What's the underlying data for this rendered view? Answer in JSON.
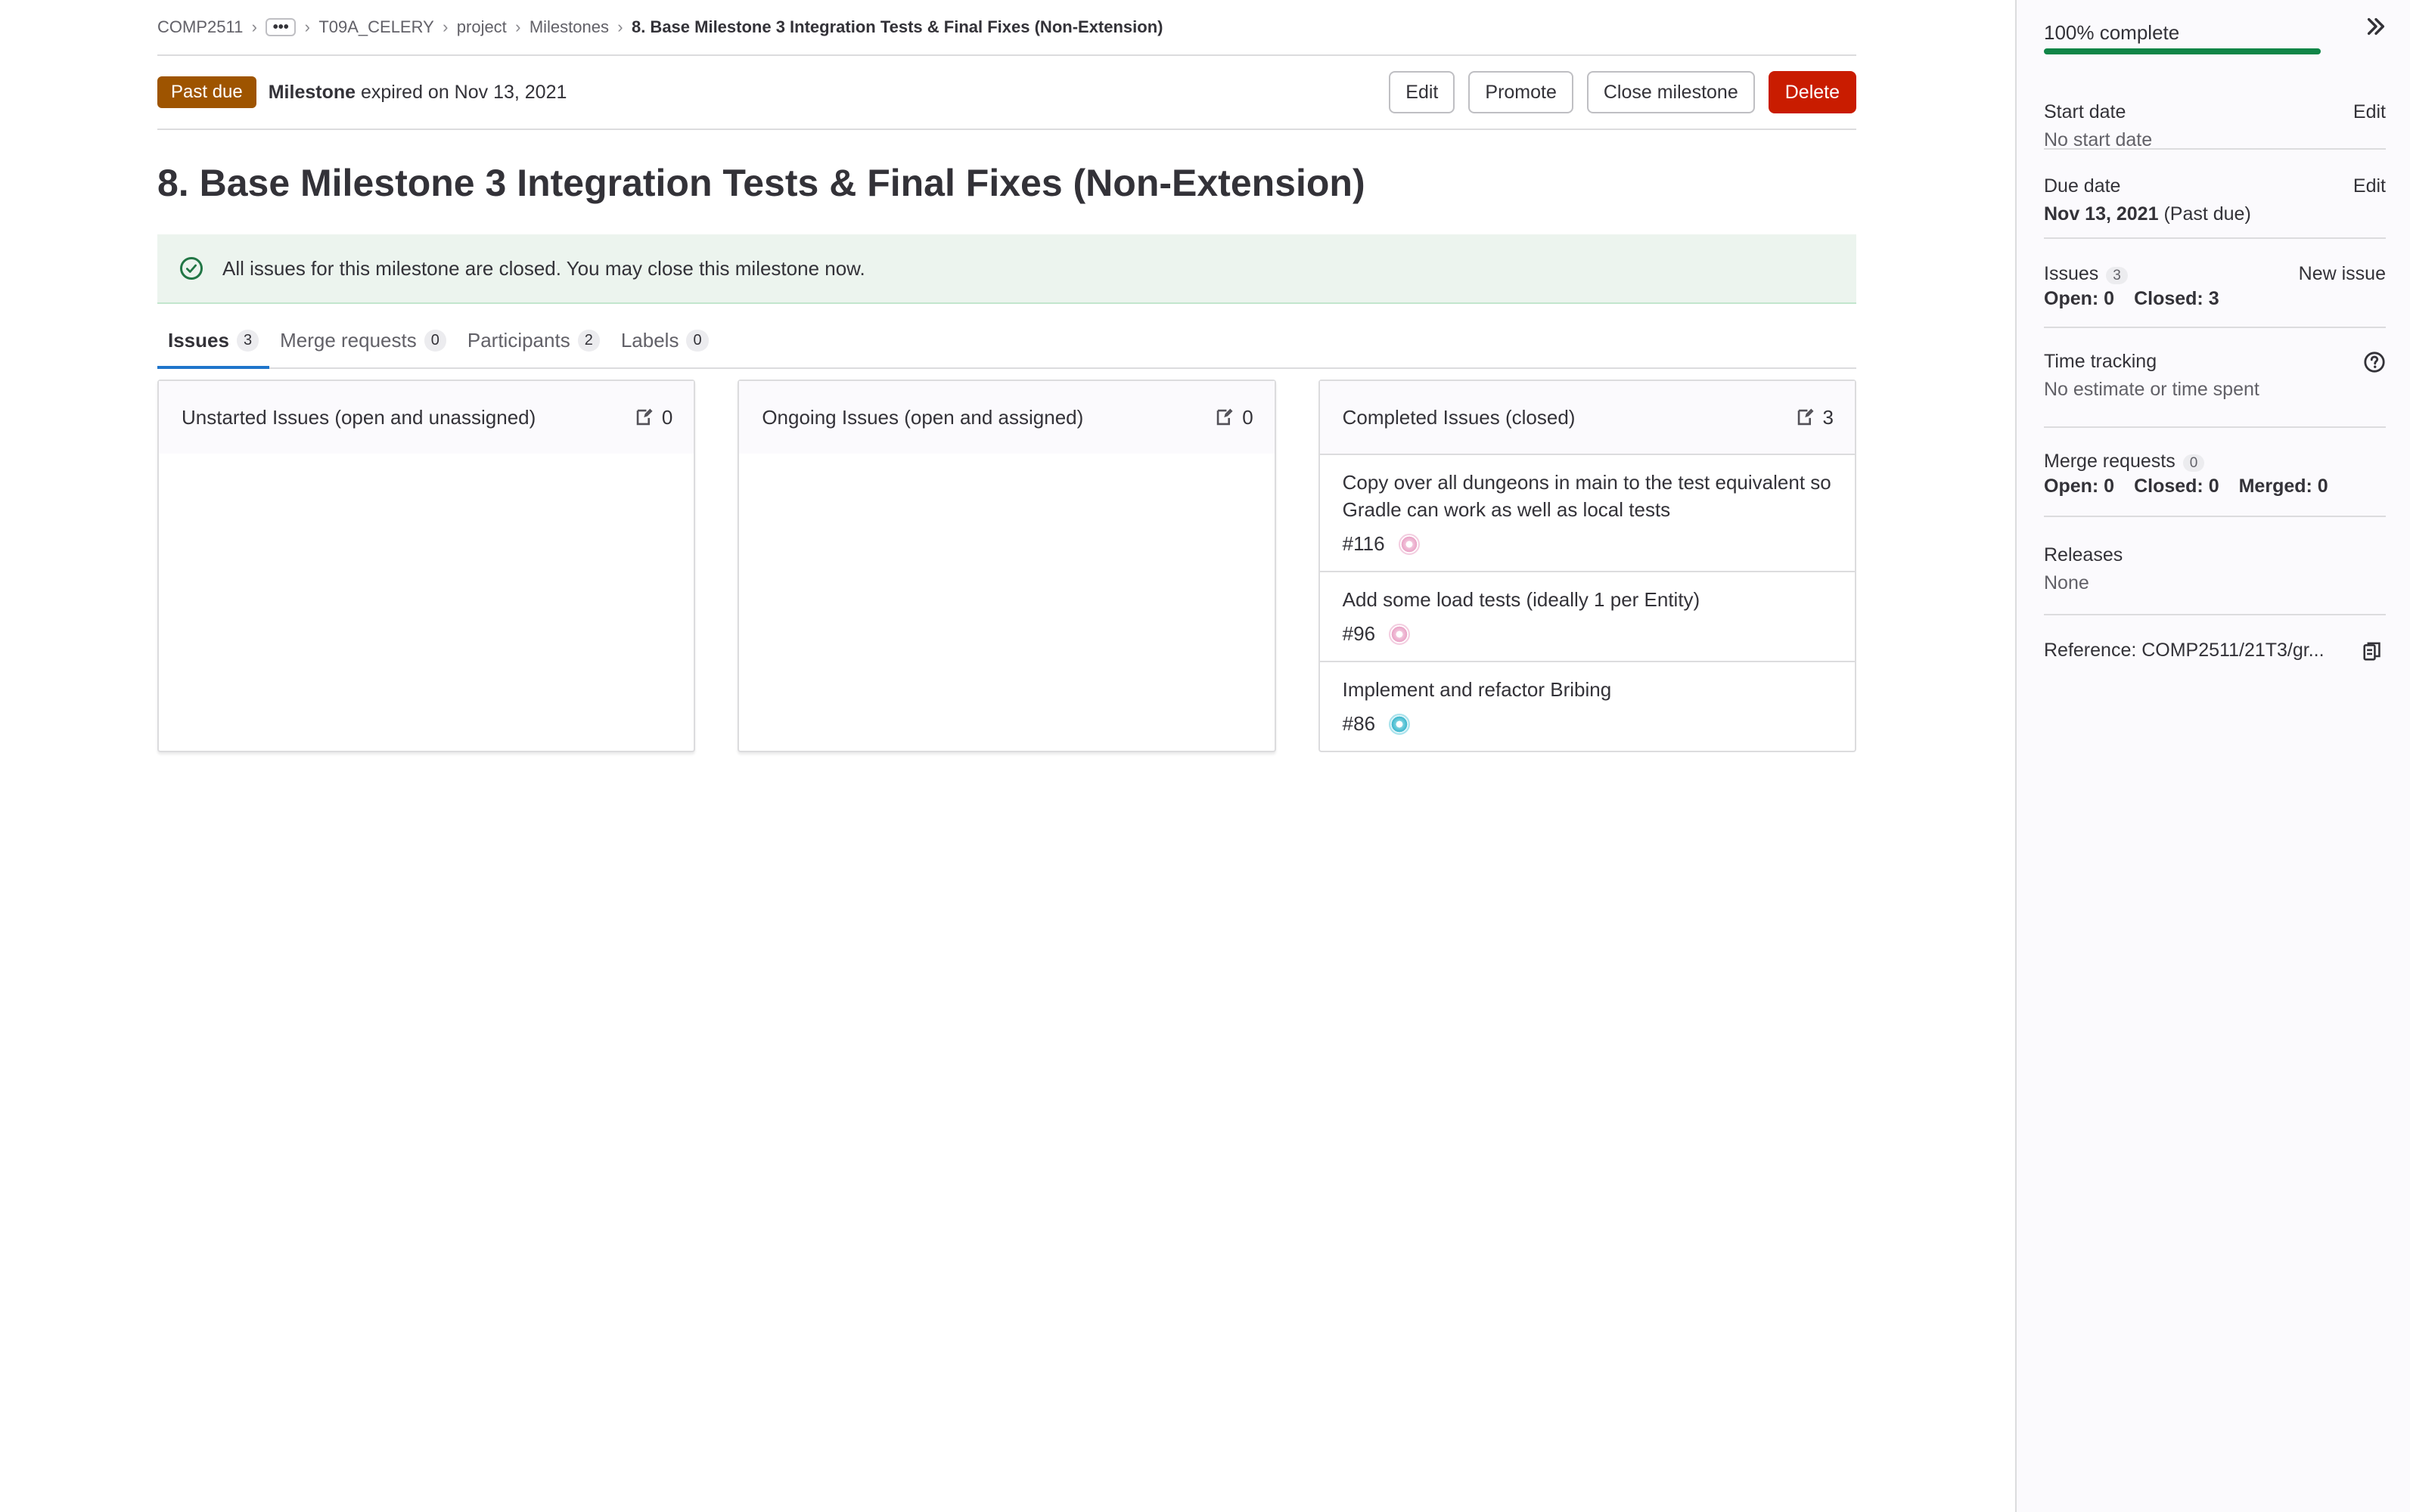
{
  "breadcrumb": {
    "items": [
      "COMP2511",
      "T09A_CELERY",
      "project",
      "Milestones"
    ],
    "ellipsis": "•••",
    "current": "8. Base Milestone 3 Integration Tests & Final Fixes (Non-Extension)"
  },
  "header": {
    "status_badge": "Past due",
    "expired_bold": "Milestone",
    "expired_text": "expired on Nov 13, 2021",
    "buttons": {
      "edit": "Edit",
      "promote": "Promote",
      "close": "Close milestone",
      "delete": "Delete"
    }
  },
  "title": "8. Base Milestone 3 Integration Tests & Final Fixes (Non-Extension)",
  "alert": {
    "text": "All issues for this milestone are closed. You may close this milestone now."
  },
  "tabs": [
    {
      "label": "Issues",
      "count": "3",
      "active": true
    },
    {
      "label": "Merge requests",
      "count": "0"
    },
    {
      "label": "Participants",
      "count": "2"
    },
    {
      "label": "Labels",
      "count": "0"
    }
  ],
  "columns": {
    "unstarted": {
      "title": "Unstarted Issues (open and unassigned)",
      "count": "0"
    },
    "ongoing": {
      "title": "Ongoing Issues (open and assigned)",
      "count": "0"
    },
    "completed": {
      "title": "Completed Issues (closed)",
      "count": "3",
      "issues": [
        {
          "title": "Copy over all dungeons in main to the test equivalent so Gradle can work as well as local tests",
          "ref": "#116",
          "avatar": "pink"
        },
        {
          "title": "Add some load tests (ideally 1 per Entity)",
          "ref": "#96",
          "avatar": "pink"
        },
        {
          "title": "Implement and refactor Bribing",
          "ref": "#86",
          "avatar": "teal"
        }
      ]
    }
  },
  "sidebar": {
    "progress_label": "100% complete",
    "progress_value": 100,
    "start_date": {
      "label": "Start date",
      "value": "No start date",
      "edit": "Edit"
    },
    "due_date": {
      "label": "Due date",
      "value": "Nov 13, 2021",
      "suffix": "(Past due)",
      "edit": "Edit"
    },
    "issues": {
      "label": "Issues",
      "count": "3",
      "new_issue": "New issue",
      "open": "Open: 0",
      "closed": "Closed: 3"
    },
    "time_tracking": {
      "label": "Time tracking",
      "value": "No estimate or time spent"
    },
    "merge_requests": {
      "label": "Merge requests",
      "count": "0",
      "open": "Open: 0",
      "closed": "Closed: 0",
      "merged": "Merged: 0"
    },
    "releases": {
      "label": "Releases",
      "value": "None"
    },
    "reference": {
      "text": "Reference: COMP2511/21T3/gr..."
    }
  },
  "colors": {
    "past_due": "#9e5400",
    "danger": "#c91c00",
    "success": "#108548",
    "tab_active": "#1f75cb"
  }
}
